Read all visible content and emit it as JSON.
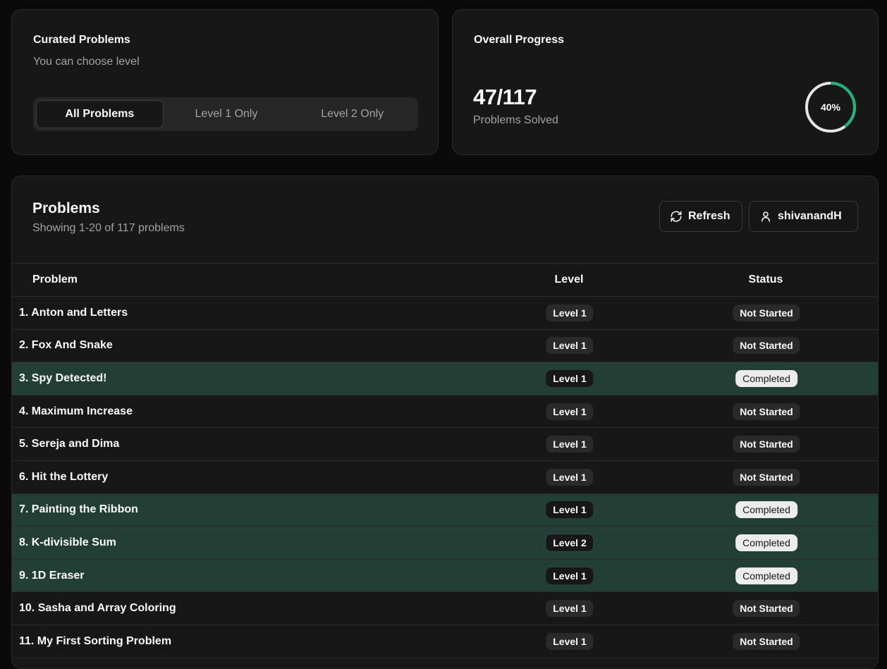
{
  "curated": {
    "title": "Curated Problems",
    "subtitle": "You can choose level",
    "filters": [
      "All Problems",
      "Level 1 Only",
      "Level 2 Only"
    ],
    "active_filter": "All Problems"
  },
  "progress": {
    "title": "Overall Progress",
    "solved_count": "47/117",
    "solved_label": "Problems Solved",
    "percent_label": "40%",
    "percent_value": 40
  },
  "problems": {
    "title": "Problems",
    "subtitle": "Showing 1-20 of 117 problems",
    "refresh_label": "Refresh",
    "username": "shivanandH",
    "columns": {
      "problem": "Problem",
      "level": "Level",
      "status": "Status"
    },
    "rows": [
      {
        "name": "1. Anton and Letters",
        "level": "Level 1",
        "status": "Not Started"
      },
      {
        "name": "2. Fox And Snake",
        "level": "Level 1",
        "status": "Not Started"
      },
      {
        "name": "3. Spy Detected!",
        "level": "Level 1",
        "status": "Completed"
      },
      {
        "name": "4. Maximum Increase",
        "level": "Level 1",
        "status": "Not Started"
      },
      {
        "name": "5. Sereja and Dima",
        "level": "Level 1",
        "status": "Not Started"
      },
      {
        "name": "6. Hit the Lottery",
        "level": "Level 1",
        "status": "Not Started"
      },
      {
        "name": "7. Painting the Ribbon",
        "level": "Level 1",
        "status": "Completed"
      },
      {
        "name": "8. K-divisible Sum",
        "level": "Level 2",
        "status": "Completed"
      },
      {
        "name": "9. 1D Eraser",
        "level": "Level 1",
        "status": "Completed"
      },
      {
        "name": "10. Sasha and Array Coloring",
        "level": "Level 1",
        "status": "Not Started"
      },
      {
        "name": "11. My First Sorting Problem",
        "level": "Level 1",
        "status": "Not Started"
      }
    ]
  },
  "colors": {
    "ring_progress": "#22b07d",
    "ring_track": "#e5e5e5",
    "completed_row": "#233e35"
  }
}
